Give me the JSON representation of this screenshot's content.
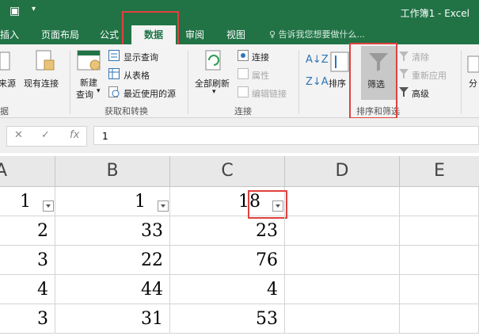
{
  "window": {
    "title": "工作簿1 - Excel"
  },
  "tabs": [
    {
      "label": "插入"
    },
    {
      "label": "页面布局"
    },
    {
      "label": "公式"
    },
    {
      "label": "数据"
    },
    {
      "label": "审阅"
    },
    {
      "label": "视图"
    }
  ],
  "tellme": "告诉我您想要做什么...",
  "ribbon": {
    "get_transform": {
      "new_source_partial": "来源",
      "existing_connections": "现有连接",
      "new_query_line1": "新建",
      "new_query_line2": "查询",
      "show_queries": "显示查询",
      "from_table": "从表格",
      "recent_sources": "最近使用的源",
      "group_label": "获取和转换",
      "left_group_partial": "据"
    },
    "connections": {
      "refresh_all": "全部刷新",
      "connections": "连接",
      "properties": "属性",
      "edit_links": "编辑链接",
      "group_label": "连接"
    },
    "sort_filter": {
      "sort": "排序",
      "filter": "筛选",
      "clear": "清除",
      "reapply": "重新应用",
      "advanced": "高级",
      "group_label": "排序和筛选",
      "right_partial": "分"
    }
  },
  "formula_bar": {
    "value": "1"
  },
  "columns": [
    "A",
    "B",
    "C",
    "D",
    "E"
  ],
  "rows": [
    [
      "1",
      "1",
      "18",
      "",
      ""
    ],
    [
      "2",
      "33",
      "23",
      "",
      ""
    ],
    [
      "3",
      "22",
      "76",
      "",
      ""
    ],
    [
      "4",
      "44",
      "4",
      "",
      ""
    ],
    [
      "3",
      "31",
      "53",
      "",
      ""
    ]
  ],
  "colors": {
    "excel_green": "#217346",
    "highlight_red": "#e0413e"
  }
}
